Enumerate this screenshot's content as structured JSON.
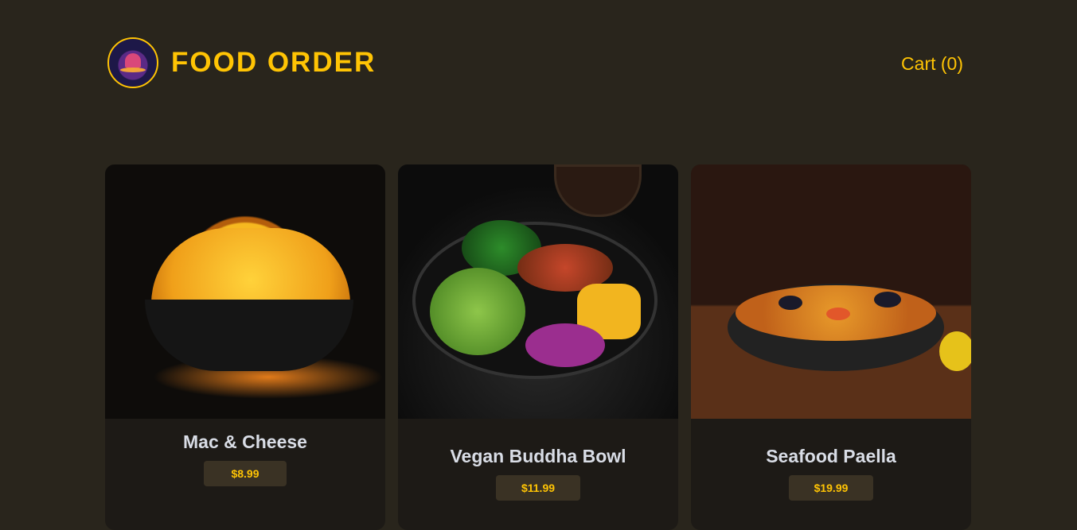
{
  "header": {
    "title": "FOOD ORDER",
    "cart_label": "Cart (0)"
  },
  "meals": [
    {
      "name": "Mac & Cheese",
      "price": "$8.99"
    },
    {
      "name": "Vegan Buddha Bowl",
      "price": "$11.99"
    },
    {
      "name": "Seafood Paella",
      "price": "$19.99"
    }
  ],
  "colors": {
    "background": "#29251c",
    "accent": "#ffc404",
    "card": "#1d1a16",
    "price_badge": "#3a3224"
  }
}
